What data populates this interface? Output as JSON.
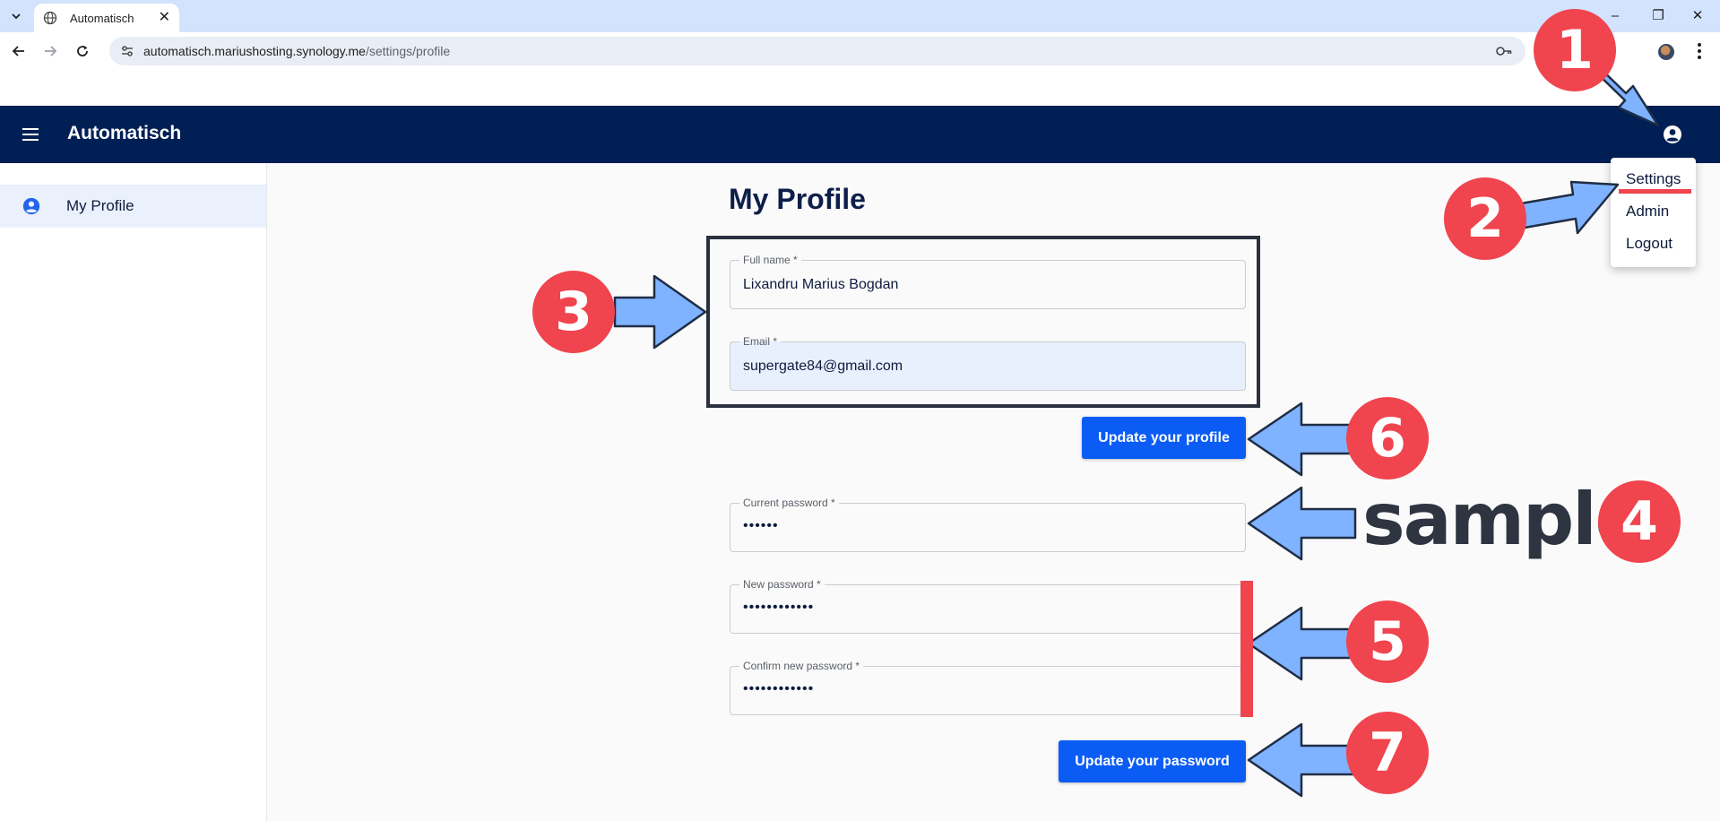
{
  "browser": {
    "tab_title": "Automatisch",
    "url_host": "automatisch.mariushosting.synology.me",
    "url_path": "/settings/profile",
    "window_controls": {
      "minimize": "–",
      "restore": "❐",
      "close": "✕"
    }
  },
  "app": {
    "title": "Automatisch",
    "sidebar": {
      "items": [
        {
          "label": "My Profile",
          "icon": "account-circle-icon"
        }
      ]
    },
    "account_menu": {
      "items": [
        "Settings",
        "Admin",
        "Logout"
      ]
    }
  },
  "profile": {
    "title": "My Profile",
    "full_name": {
      "label": "Full name *",
      "value": "Lixandru Marius Bogdan"
    },
    "email": {
      "label": "Email *",
      "value": "supergate84@gmail.com"
    },
    "update_profile_label": "Update your profile",
    "current_password": {
      "label": "Current password *",
      "value": "••••••"
    },
    "new_password": {
      "label": "New password *",
      "value": "••••••••••••"
    },
    "confirm_password": {
      "label": "Confirm new password *",
      "value": "••••••••••••"
    },
    "update_password_label": "Update your password"
  },
  "annotations": {
    "badges": [
      "1",
      "2",
      "3",
      "4",
      "5",
      "6",
      "7"
    ],
    "watermark": "sample",
    "colors": {
      "badge": "#f0444e",
      "arrow": "#7fb2ff",
      "arrow_outline": "#1f2d45",
      "accent_line": "#f0444e"
    }
  },
  "colors": {
    "appbar": "#001f55",
    "primary_button": "#0b5cf5",
    "sidebar_active": "#eaf1fd"
  }
}
